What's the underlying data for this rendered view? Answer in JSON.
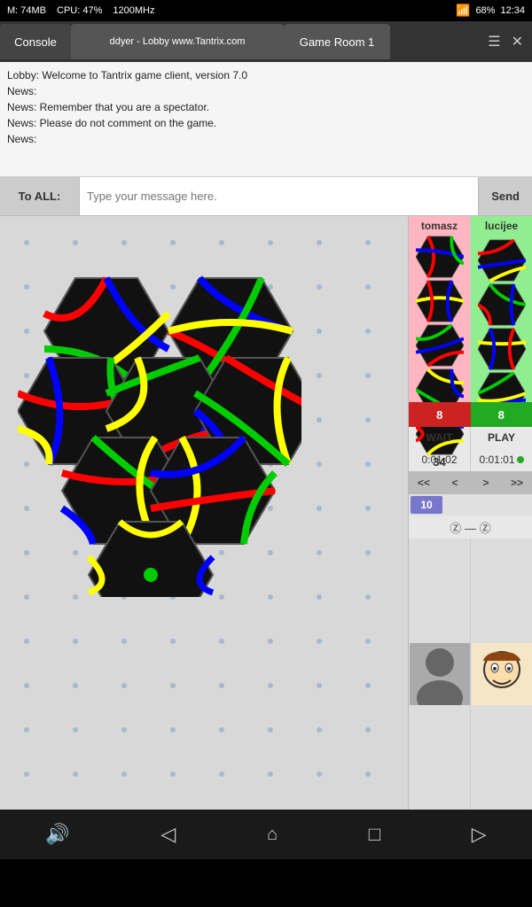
{
  "statusBar": {
    "memInfo": "M: 74MB",
    "cpuInfo": "CPU: 47%",
    "freq": "1200MHz",
    "battery": "68%",
    "time": "12:34"
  },
  "tabs": [
    {
      "id": "console",
      "label": "Console",
      "active": false
    },
    {
      "id": "lobby",
      "label": "ddyer - Lobby www.Tantrix.com",
      "active": false
    },
    {
      "id": "gameroom",
      "label": "Game Room 1",
      "active": true
    }
  ],
  "tabIcons": {
    "menu": "☰",
    "overflow": ">",
    "close": "✕"
  },
  "chat": {
    "messages": [
      "Lobby: Welcome to Tantrix game client, version 7.0",
      "News:",
      "News: Remember that you are a spectator.",
      "News: Please do not comment on the game.",
      "News:"
    ]
  },
  "messageBar": {
    "toLabel": "To ALL:",
    "placeholder": "Type your message here.",
    "sendLabel": "Send"
  },
  "players": [
    {
      "name": "tomasz",
      "score": "34",
      "tileCount": 5,
      "bgColor": "pink"
    },
    {
      "name": "lucijee",
      "bgColor": "green",
      "indicatorColor": "#6699ff"
    }
  ],
  "scoreBadges": [
    {
      "value": "8",
      "color": "red"
    },
    {
      "value": "8",
      "color": "green"
    }
  ],
  "statusLabels": [
    "WAIT",
    "PLAY"
  ],
  "timers": [
    "0:01:02",
    "0:01:01"
  ],
  "navButtons": [
    "<<",
    "<",
    ">",
    ">>"
  ],
  "moveCounter": "10",
  "symbols": "Ⓩ — Ⓩ",
  "navBar": {
    "volume": "🔊",
    "back": "◁",
    "home": "⌂",
    "recent": "□",
    "forward": "▷"
  }
}
